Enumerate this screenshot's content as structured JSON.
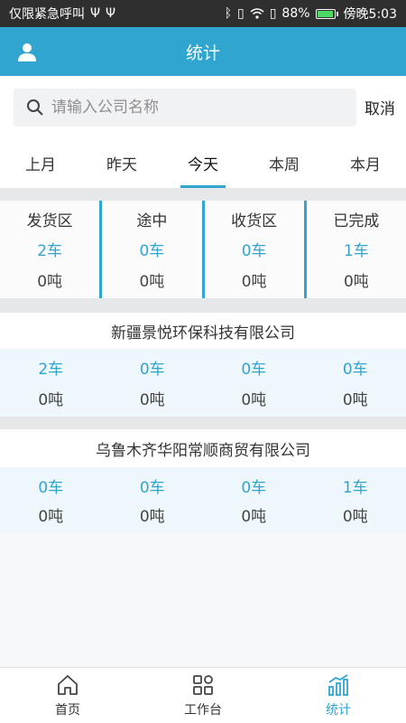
{
  "status_bar": {
    "left_text": "仅限紧急呼叫",
    "battery": "88%",
    "battery_level": 0.88,
    "time": "傍晚5:03"
  },
  "header": {
    "title": "统计"
  },
  "search": {
    "placeholder": "请输入公司名称",
    "value": "",
    "cancel_label": "取消"
  },
  "tabs": [
    {
      "label": "上月"
    },
    {
      "label": "昨天"
    },
    {
      "label": "今天",
      "active": true
    },
    {
      "label": "本周"
    },
    {
      "label": "本月"
    }
  ],
  "summary": [
    {
      "label": "发货区",
      "cars": "2车",
      "tons": "0吨"
    },
    {
      "label": "途中",
      "cars": "0车",
      "tons": "0吨"
    },
    {
      "label": "收货区",
      "cars": "0车",
      "tons": "0吨"
    },
    {
      "label": "已完成",
      "cars": "1车",
      "tons": "0吨"
    }
  ],
  "companies": [
    {
      "name": "新疆景悦环保科技有限公司",
      "stats": [
        {
          "cars": "2车",
          "tons": "0吨"
        },
        {
          "cars": "0车",
          "tons": "0吨"
        },
        {
          "cars": "0车",
          "tons": "0吨"
        },
        {
          "cars": "0车",
          "tons": "0吨"
        }
      ]
    },
    {
      "name": "乌鲁木齐华阳常顺商贸有限公司",
      "stats": [
        {
          "cars": "0车",
          "tons": "0吨"
        },
        {
          "cars": "0车",
          "tons": "0吨"
        },
        {
          "cars": "0车",
          "tons": "0吨"
        },
        {
          "cars": "1车",
          "tons": "0吨"
        }
      ]
    }
  ],
  "bottom_nav": [
    {
      "label": "首页",
      "icon": "home-icon"
    },
    {
      "label": "工作台",
      "icon": "grid-icon"
    },
    {
      "label": "统计",
      "icon": "stats-icon",
      "active": true
    }
  ],
  "colors": {
    "accent": "#2fa5cf",
    "status_bar": "#2f2f2f",
    "gap": "#e6e7e9"
  }
}
